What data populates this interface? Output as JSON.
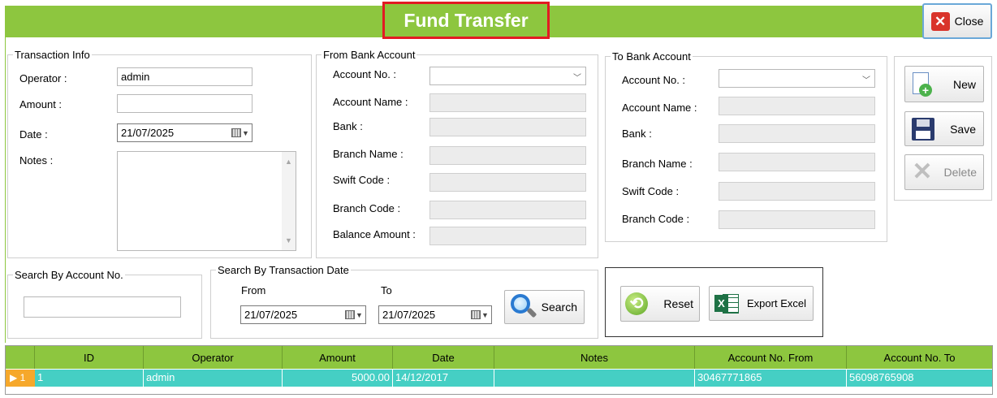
{
  "window": {
    "title": "Fund Transfer",
    "close_label": "Close"
  },
  "transaction_info": {
    "legend": "Transaction Info",
    "operator_label": "Operator :",
    "operator_value": "admin",
    "amount_label": "Amount :",
    "amount_value": "",
    "date_label": "Date :",
    "date_value": "21/07/2025",
    "notes_label": "Notes :",
    "notes_value": ""
  },
  "from_account": {
    "legend": "From Bank Account",
    "account_no_label": "Account No. :",
    "account_name_label": "Account Name :",
    "bank_label": "Bank :",
    "branch_name_label": "Branch Name :",
    "swift_code_label": "Swift Code :",
    "branch_code_label": "Branch Code :",
    "balance_amount_label": "Balance Amount :"
  },
  "to_account": {
    "legend": "To Bank Account",
    "account_no_label": "Account No. :",
    "account_name_label": "Account Name :",
    "bank_label": "Bank :",
    "branch_name_label": "Branch Name :",
    "swift_code_label": "Swift Code :",
    "branch_code_label": "Branch Code :"
  },
  "actions": {
    "new_label": "New",
    "save_label": "Save",
    "delete_label": "Delete"
  },
  "search_account": {
    "legend": "Search By Account No.",
    "value": ""
  },
  "search_date": {
    "legend": "Search By Transaction Date",
    "from_label": "From",
    "from_value": "21/07/2025",
    "to_label": "To",
    "to_value": "21/07/2025",
    "search_label": "Search"
  },
  "tools": {
    "reset_label": "Reset",
    "export_label": "Export Excel"
  },
  "table": {
    "columns": [
      "ID",
      "Operator",
      "Amount",
      "Date",
      "Notes",
      "Account No. From",
      "Account No. To"
    ],
    "row_indicator": "1",
    "rows": [
      {
        "id": "1",
        "operator": "admin",
        "amount": "5000.00",
        "date": "14/12/2017",
        "notes": "",
        "account_from": "30467771865",
        "account_to": "56098765908"
      }
    ]
  },
  "colors": {
    "accent_green": "#8dc63f",
    "selected_row": "#45cfc4",
    "title_border": "#e21b23",
    "row_indicator": "#f6a82b"
  }
}
